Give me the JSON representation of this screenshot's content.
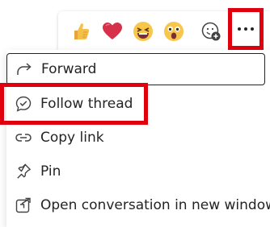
{
  "reactions": [
    {
      "name": "like",
      "icon": "thumbs-up-emoji-icon"
    },
    {
      "name": "heart",
      "icon": "heart-emoji-icon"
    },
    {
      "name": "laugh",
      "icon": "laughing-emoji-icon"
    },
    {
      "name": "surprised",
      "icon": "surprised-emoji-icon"
    },
    {
      "name": "add-reaction",
      "icon": "add-emoji-icon"
    }
  ],
  "more_button": {
    "icon": "more-options-icon"
  },
  "menu": {
    "items": [
      {
        "label": "Forward",
        "icon": "forward-arrow-icon"
      },
      {
        "label": "Follow thread",
        "icon": "follow-thread-icon"
      },
      {
        "label": "Copy link",
        "icon": "link-icon"
      },
      {
        "label": "Pin",
        "icon": "pin-icon"
      },
      {
        "label": "Open conversation in new window",
        "icon": "open-new-window-icon"
      }
    ]
  },
  "colors": {
    "highlight": "#e0000d",
    "text": "#242424",
    "accent": "#6264a7"
  }
}
